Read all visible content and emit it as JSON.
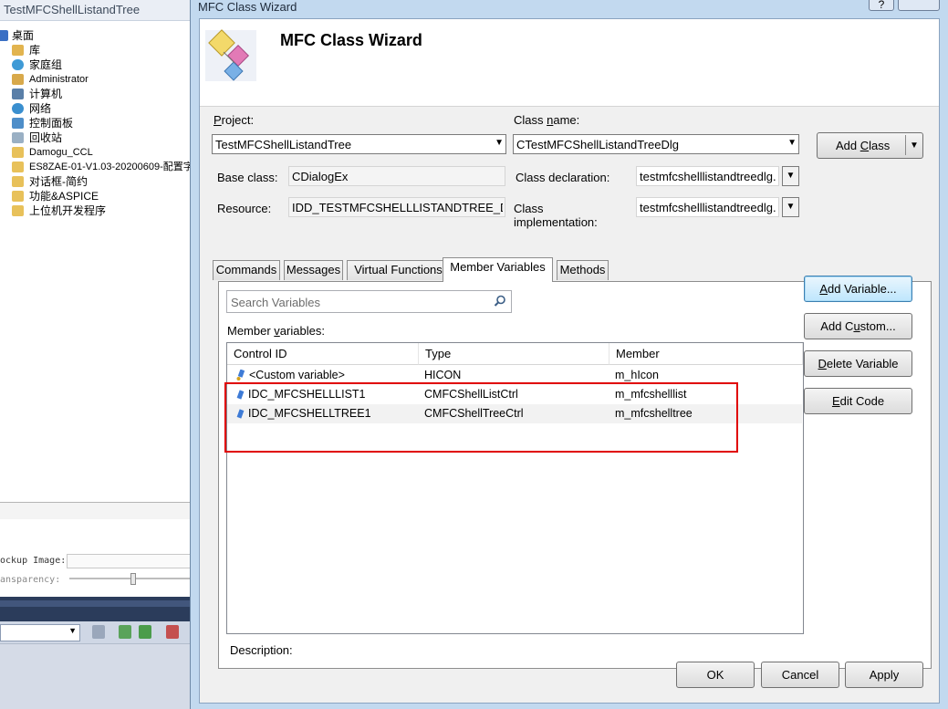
{
  "ide": {
    "window_title": "TestMFCShellListandTree",
    "tree_items": [
      {
        "label": "桌面",
        "icon": "desktop-icon",
        "color": "#3a6fc4"
      },
      {
        "label": "库",
        "icon": "library-icon",
        "color": "#e2b44f"
      },
      {
        "label": "家庭组",
        "icon": "homegroup-icon",
        "color": "#3f9ad6"
      },
      {
        "label": "Administrator",
        "icon": "user-folder-icon",
        "color": "#d8a94b"
      },
      {
        "label": "计算机",
        "icon": "computer-icon",
        "color": "#5a7fa8"
      },
      {
        "label": "网络",
        "icon": "network-icon",
        "color": "#3a8fcf"
      },
      {
        "label": "控制面板",
        "icon": "control-panel-icon",
        "color": "#4e8ec9"
      },
      {
        "label": "回收站",
        "icon": "recycle-bin-icon",
        "color": "#9ab0c4"
      },
      {
        "label": "Damogu_CCL",
        "icon": "folder-icon",
        "color": "#e8c15a"
      },
      {
        "label": "ES8ZAE-01-V1.03-20200609-配置字",
        "icon": "folder-icon",
        "color": "#e8c15a"
      },
      {
        "label": "对话框-简约",
        "icon": "folder-icon",
        "color": "#e8c15a"
      },
      {
        "label": "功能&ASPICE",
        "icon": "folder-icon",
        "color": "#e8c15a"
      },
      {
        "label": "上位机开发程序",
        "icon": "folder-icon",
        "color": "#e8c15a"
      }
    ],
    "props": {
      "mockup_label": "ockup Image:",
      "transparency_label": "ansparency:",
      "transparency_level": 0.52
    }
  },
  "dialog": {
    "title": "MFC Class Wizard",
    "help_label": "?",
    "header_title": "MFC Class Wizard",
    "project_label_u": "P",
    "project_label_rest": "roject:",
    "project_value": "TestMFCShellListandTree",
    "classname_label_a": "Class ",
    "classname_label_u": "n",
    "classname_label_b": "ame:",
    "classname_value": "CTestMFCShellListandTreeDlg",
    "add_class_a": "Add ",
    "add_class_u": "C",
    "add_class_b": "lass",
    "base_class_label": "Base class:",
    "base_class_value": "CDialogEx",
    "class_decl_label": "Class declaration:",
    "class_decl_value": "testmfcshelllistandtreedlg.",
    "resource_label": "Resource:",
    "resource_value": "IDD_TESTMFCSHELLLISTANDTREE_DIALOG",
    "class_impl_label_1": "Class",
    "class_impl_label_2": "implementation:",
    "class_impl_value": "testmfcshelllistandtreedlg.",
    "tabs": [
      "Commands",
      "Messages",
      "Virtual Functions",
      "Member Variables",
      "Methods"
    ],
    "active_tab": "Member Variables",
    "search_placeholder": "Search Variables",
    "member_vars_label_a": "Member ",
    "member_vars_label_u": "v",
    "member_vars_label_b": "ariables:",
    "columns": [
      "Control ID",
      "Type",
      "Member"
    ],
    "rows": [
      {
        "control_id": "<Custom variable>",
        "type": "HICON",
        "member": "m_hIcon",
        "icon": "custom-variable-icon"
      },
      {
        "control_id": "IDC_MFCSHELLLIST1",
        "type": "CMFCShellListCtrl",
        "member": "m_mfcshelllist",
        "icon": "control-variable-icon"
      },
      {
        "control_id": "IDC_MFCSHELLTREE1",
        "type": "CMFCShellTreeCtrl",
        "member": "m_mfcshelltree",
        "icon": "control-variable-icon"
      }
    ],
    "highlight_color": "#e00000",
    "description_label": "Description:",
    "add_variable_u": "A",
    "add_variable_rest": "dd Variable...",
    "add_custom_a": "Add C",
    "add_custom_u": "u",
    "add_custom_b": "stom...",
    "delete_variable_u": "D",
    "delete_variable_rest": "elete Variable",
    "edit_code_u": "E",
    "edit_code_rest": "dit Code",
    "ok_label": "OK",
    "cancel_label": "Cancel",
    "apply_label": "Apply"
  }
}
